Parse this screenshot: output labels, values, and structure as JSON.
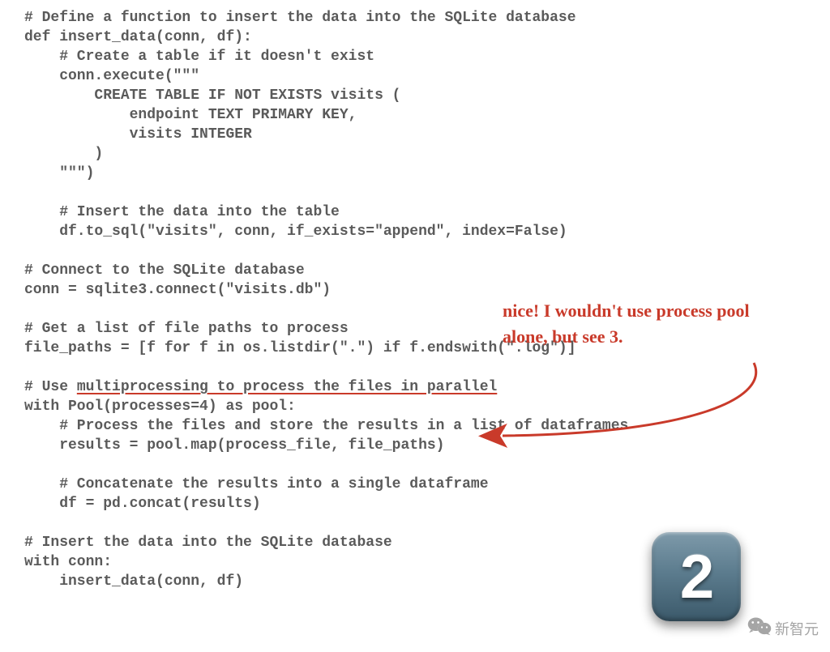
{
  "code": {
    "l01": "# Define a function to insert the data into the SQLite database",
    "l02": "def insert_data(conn, df):",
    "l03": "    # Create a table if it doesn't exist",
    "l04": "    conn.execute(\"\"\"",
    "l05": "        CREATE TABLE IF NOT EXISTS visits (",
    "l06": "            endpoint TEXT PRIMARY KEY,",
    "l07": "            visits INTEGER",
    "l08": "        )",
    "l09": "    \"\"\")",
    "l10": "",
    "l11": "    # Insert the data into the table",
    "l12": "    df.to_sql(\"visits\", conn, if_exists=\"append\", index=False)",
    "l13": "",
    "l14": "# Connect to the SQLite database",
    "l15": "conn = sqlite3.connect(\"visits.db\")",
    "l16": "",
    "l17": "# Get a list of file paths to process",
    "l18": "file_paths = [f for f in os.listdir(\".\") if f.endswith(\".log\")]",
    "l19": "",
    "l20a": "# Use ",
    "l20b": "multiprocessing to process the files in parallel",
    "l21": "with Pool(processes=4) as pool:",
    "l22": "    # Process the files and store the results in a list of dataframes",
    "l23": "    results = pool.map(process_file, file_paths)",
    "l24": "",
    "l25": "    # Concatenate the results into a single dataframe",
    "l26": "    df = pd.concat(results)",
    "l27": "",
    "l28": "# Insert the data into the SQLite database",
    "l29": "with conn:",
    "l30": "    insert_data(conn, df)"
  },
  "annotation": "nice! I wouldn't use process pool alone, but see 3.",
  "badge": "2",
  "watermark": "新智元"
}
